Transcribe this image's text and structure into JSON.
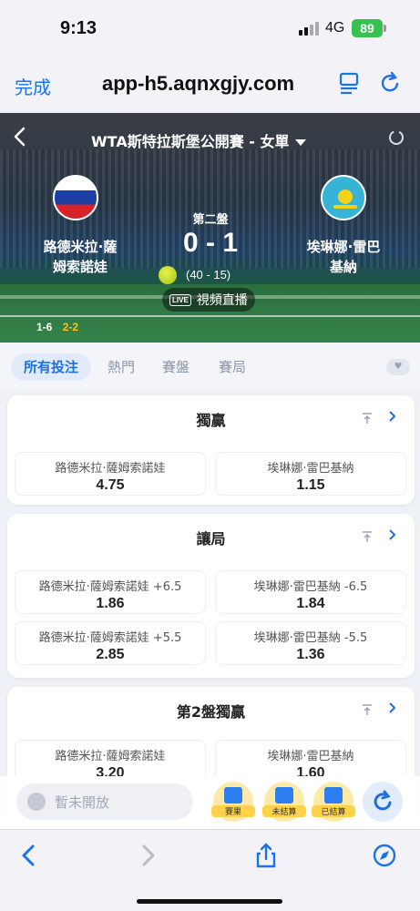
{
  "status": {
    "time": "9:13",
    "network": "4G",
    "battery": "89"
  },
  "browser": {
    "done_label": "完成",
    "url": "app-h5.aqnxgjy.com"
  },
  "match": {
    "title": "WTA斯特拉斯堡公開賽 - 女單",
    "set_label": "第二盤",
    "score": "0 - 1",
    "game_score": "(40 - 15)",
    "live_tag": "LIVE",
    "live_label": "視頻直播",
    "player_left_line1": "路德米拉·薩",
    "player_left_line2": "姆索諾娃",
    "player_right_line1": "埃琳娜·雷巴",
    "player_right_line2": "基納",
    "set1_score": "1-6",
    "set2_score": "2-2",
    "flag_left": "russia-flag",
    "flag_right": "kazakhstan-flag"
  },
  "tabs": [
    "所有投注",
    "熱門",
    "賽盤",
    "賽局"
  ],
  "markets": {
    "winner": {
      "title": "獨贏",
      "options": [
        {
          "name": "路德米拉·薩姆索諾娃",
          "price": "4.75"
        },
        {
          "name": "埃琳娜·雷巴基納",
          "price": "1.15"
        }
      ]
    },
    "handicap": {
      "title": "讓局",
      "options": [
        {
          "name": "路德米拉·薩姆索諾娃 +6.5",
          "price": "1.86"
        },
        {
          "name": "埃琳娜·雷巴基納 -6.5",
          "price": "1.84"
        },
        {
          "name": "路德米拉·薩姆索諾娃 +5.5",
          "price": "2.85"
        },
        {
          "name": "埃琳娜·雷巴基納 -5.5",
          "price": "1.36"
        }
      ]
    },
    "set2_winner": {
      "title": "第2盤獨贏",
      "options": [
        {
          "name": "路德米拉·薩姆索諾娃",
          "price": "3.20"
        },
        {
          "name": "埃琳娜·雷巴基納",
          "price": "1.60"
        }
      ]
    }
  },
  "actionbar": {
    "chat_placeholder": "暫未開放",
    "result_label": "賽果",
    "unsettled_label": "未結算",
    "settled_label": "已結算"
  },
  "colors": {
    "accent": "#1e6fe0",
    "ios_blue": "#1a73e8",
    "battery": "#37c24f"
  }
}
